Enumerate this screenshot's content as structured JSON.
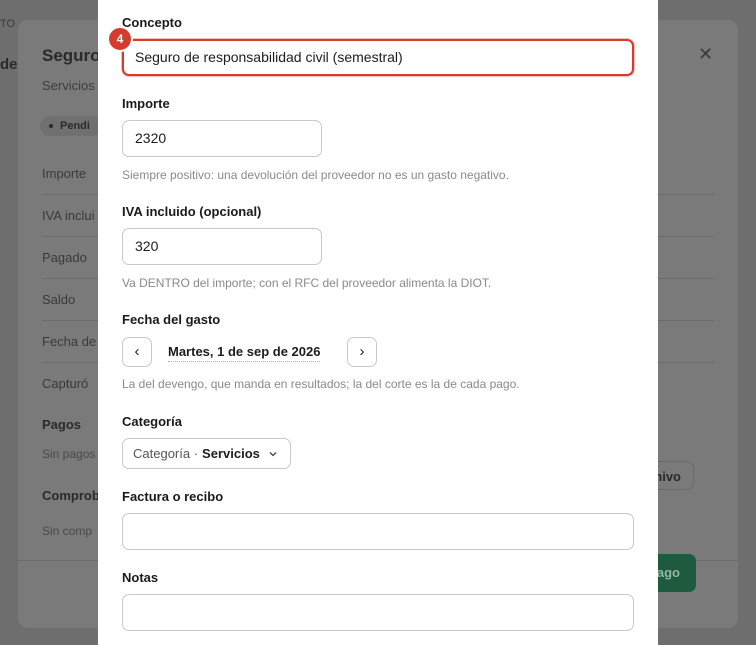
{
  "background": {
    "crumb": "TO",
    "de": "de"
  },
  "detail": {
    "title": "Seguro",
    "subtitle": "Servicios",
    "badge": "Pendi",
    "rows": [
      "Importe",
      "IVA inclui",
      "Pagado",
      "Saldo",
      "Fecha de",
      "Capturó"
    ],
    "pagos_heading": "Pagos",
    "pagos_empty": "Sin pagos",
    "comprob_heading": "Comprob",
    "comprob_empty": "Sin comp",
    "archivo_button": "archivo",
    "pago_button": "r pago",
    "close_icon": "close-icon"
  },
  "form": {
    "step_badge": "4",
    "concepto": {
      "label": "Concepto",
      "value": "Seguro de responsabilidad civil (semestral)"
    },
    "importe": {
      "label": "Importe",
      "value": "2320",
      "hint": "Siempre positivo: una devolución del proveedor no es un gasto negativo."
    },
    "iva": {
      "label": "IVA incluido (opcional)",
      "value": "320",
      "hint": "Va DENTRO del importe; con el RFC del proveedor alimenta la DIOT."
    },
    "fecha": {
      "label": "Fecha del gasto",
      "prev": "‹",
      "value": "Martes, 1 de sep de 2026",
      "next": "›",
      "hint": "La del devengo, que manda en resultados; la del corte es la de cada pago."
    },
    "categoria": {
      "label": "Categoría",
      "prefix": "Categoría ·",
      "value": "Servicios"
    },
    "factura": {
      "label": "Factura o recibo",
      "value": ""
    },
    "notas": {
      "label": "Notas",
      "value": ""
    }
  },
  "colors": {
    "focus_ring": "#d63b2f",
    "primary_button": "#1d5a3e"
  }
}
